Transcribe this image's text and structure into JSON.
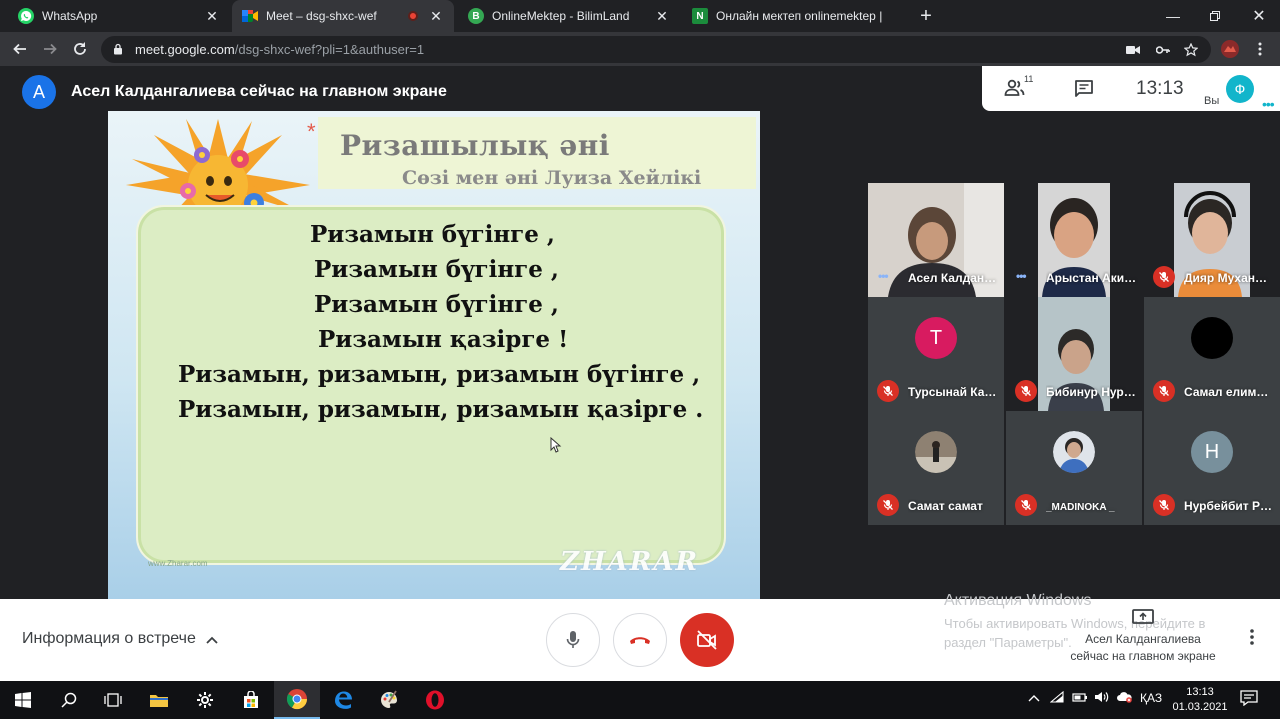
{
  "browser": {
    "tabs": [
      {
        "title": "WhatsApp",
        "favicon_color": "#25d366",
        "favicon_letter": "",
        "active": false,
        "recording": false
      },
      {
        "title": "Meet – dsg-shxc-wef",
        "favicon_color": "#00897b",
        "favicon_letter": "",
        "active": true,
        "recording": true
      },
      {
        "title": "OnlineMektep - BilimLand",
        "favicon_color": "#34a853",
        "favicon_letter": "B",
        "active": false,
        "recording": false
      },
      {
        "title": "Онлайн мектеп onlinemektep |",
        "favicon_color": "#1b8c3c",
        "favicon_letter": "N",
        "active": false,
        "recording": false
      }
    ],
    "url_host": "meet.google.com",
    "url_path": "/dsg-shxc-wef?pli=1&authuser=1"
  },
  "meet": {
    "presenter_initial": "A",
    "presenting_text": "Асел Калдангалиева сейчас на главном экране",
    "participants_count": "11",
    "time": "13:13",
    "self_initial": "Ф",
    "self_label": "Вы",
    "slide": {
      "title": "Ризашылық әні",
      "subtitle": "Сөзі мен әні Луиза Хейлікі",
      "lines": [
        "Ризамын бүгінге ,",
        "Ризамын бүгінге ,",
        "Ризамын бүгінге ,",
        "Ризамын қазірге !",
        "Ризамын, ризамын, ризамын бүгінге ,",
        "Ризамын, ризамын, ризамын қазірге ."
      ],
      "watermark": "ZHARAR",
      "footer_small": "www.Zharar.com"
    },
    "participants": [
      {
        "name": "Асел Калдан…",
        "muted": false,
        "speaking": true,
        "kind": "photo",
        "initial": "",
        "avatar_color": ""
      },
      {
        "name": "Арыстан Аки…",
        "muted": false,
        "speaking": true,
        "kind": "photo",
        "initial": "",
        "avatar_color": ""
      },
      {
        "name": "Дияр Мухан…",
        "muted": true,
        "speaking": false,
        "kind": "photo",
        "initial": "",
        "avatar_color": ""
      },
      {
        "name": "Турсынай Ка…",
        "muted": true,
        "speaking": false,
        "kind": "initial",
        "initial": "Т",
        "avatar_color": "#d81b60"
      },
      {
        "name": "Бибинур Нур…",
        "muted": true,
        "speaking": false,
        "kind": "photo",
        "initial": "",
        "avatar_color": ""
      },
      {
        "name": "Самал елим…",
        "muted": true,
        "speaking": false,
        "kind": "initial",
        "initial": "",
        "avatar_color": "#000000"
      },
      {
        "name": "Самат самат",
        "muted": true,
        "speaking": false,
        "kind": "small-photo",
        "initial": "",
        "avatar_color": "#7a6d60"
      },
      {
        "name": "_MADINOKA _",
        "muted": true,
        "speaking": false,
        "kind": "small-photo",
        "initial": "",
        "avatar_color": "#6f7f96"
      },
      {
        "name": "Нурбейбит Р…",
        "muted": true,
        "speaking": false,
        "kind": "initial",
        "initial": "Н",
        "avatar_color": "#78909c"
      }
    ],
    "controls": {
      "meeting_info": "Информация о встрече",
      "present_now": "Асел Калдангалиева сейчас на главном экране"
    },
    "activation": {
      "title": "Активация Windows",
      "text": "Чтобы активировать Windows, перейдите в раздел \"Параметры\"."
    }
  },
  "taskbar": {
    "language": "ҚАЗ",
    "time": "13:13",
    "date": "01.03.2021"
  },
  "colors": {
    "accent_red": "#d93025",
    "meet_blue": "#1a73e8",
    "self_avatar": "#12b5cb"
  }
}
